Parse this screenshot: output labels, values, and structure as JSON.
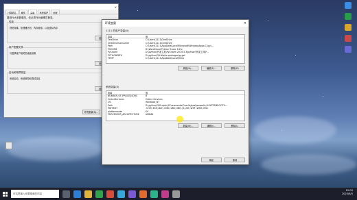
{
  "desktop": {
    "right_icons": [
      {
        "icon": "app-icon",
        "label": "",
        "color": "#3a8ee6"
      },
      {
        "icon": "app-icon",
        "label": "",
        "color": "#2a9d4a"
      },
      {
        "icon": "app-icon",
        "label": "",
        "color": "#d9a62e"
      },
      {
        "icon": "app-icon",
        "label": "",
        "color": "#c94a4a"
      },
      {
        "icon": "app-icon",
        "label": "",
        "color": "#6a6ad6"
      }
    ],
    "left_icon": {
      "icon": "document-icon",
      "label": ""
    }
  },
  "sysprops": {
    "tabs": [
      "计算机名",
      "硬件",
      "高级",
      "系统保护",
      "远程"
    ],
    "active_tab": 2,
    "note": "要进行大多数更改，你必须作为管理员登录。",
    "groups": [
      {
        "title": "性能",
        "desc": "视觉效果，处理器计划，内存使用，以及虚拟内存",
        "button": "设置(S)..."
      },
      {
        "title": "用户配置文件",
        "desc": "与登录帐户相关的桌面设置",
        "button": "设置(E)..."
      },
      {
        "title": "启动和故障恢复",
        "desc": "系统启动、系统故障和调试信息",
        "button": "设置(T)..."
      }
    ],
    "env_button": "环境变量(N)..."
  },
  "env": {
    "title": "环境变量",
    "close": "×",
    "user_section_label": "1111 的用户变量(U)",
    "columns": [
      "变量",
      "值"
    ],
    "user_vars": [
      {
        "name": "OneDrive",
        "value": "C:\\Users\\1111\\OneDrive"
      },
      {
        "name": "OneDriveConsumer",
        "value": "C:\\Users\\1111\\OneDrive"
      },
      {
        "name": "Path",
        "value": "C:\\Users\\1111\\AppData\\Local\\Microsoft\\WindowsApps;C:\\py\\..."
      },
      {
        "name": "PSHOME",
        "value": "D:\\WordCloud Python Tracer 6.2\\v"
      },
      {
        "name": "PyCharm",
        "value": "D:\\python\\开发工具\\PyCharm 2019.3.3\\python\\开发工具\\P..."
      },
      {
        "name": "PYTHONPATH",
        "value": "D:\\python\\3\\Lib\\site-packages\\pygal"
      },
      {
        "name": "TEMP",
        "value": "C:\\Users\\1111\\AppData\\Local\\Temp"
      }
    ],
    "user_buttons": [
      "新建(N)...",
      "编辑(E)...",
      "删除(D)"
    ],
    "sys_section_label": "系统变量(S)",
    "sys_vars": [
      {
        "name": "NUMBER_OF_PROCESSORS",
        "value": "8"
      },
      {
        "name": "OnlineServices",
        "value": "Online Services"
      },
      {
        "name": "OS",
        "value": "Windows_NT"
      },
      {
        "name": "Path",
        "value": "D:\\python\\3\\Scripts\\;D:\\anaconda\\Oracle\\Java\\javapath;%SYSTEMROOT%..."
      },
      {
        "name": "PATHEXT",
        "value": ".COM;.EXE;.BAT;.CMD;.VBS;.VBE;.JS;.JSE;.WSF;.WSH;.MSC"
      },
      {
        "name": "platformcode",
        "value": "KV"
      },
      {
        "name": "PROCESSOR_ARCHITECTURE",
        "value": "AMD64"
      }
    ],
    "sys_buttons": [
      "新建(W)...",
      "编辑(I)...",
      "删除(L)"
    ],
    "ok": "确定",
    "cancel": "取消"
  },
  "taskbar": {
    "search_placeholder": "在这里输入你要搜索的内容",
    "apps": [
      {
        "icon": "task-view-icon",
        "color": "#5a6270"
      },
      {
        "icon": "browser-icon",
        "color": "#2d7fd6"
      },
      {
        "icon": "explorer-icon",
        "color": "#e2b33a"
      },
      {
        "icon": "app-icon",
        "color": "#2fa24b"
      },
      {
        "icon": "app-icon",
        "color": "#d64b3a"
      },
      {
        "icon": "app-icon",
        "color": "#35a7d9"
      },
      {
        "icon": "app-icon",
        "color": "#7c5ad6"
      },
      {
        "icon": "app-icon",
        "color": "#e26a2c"
      },
      {
        "icon": "app-icon",
        "color": "#2ab38a"
      },
      {
        "icon": "app-icon",
        "color": "#c23b8e"
      },
      {
        "icon": "app-icon",
        "color": "#999999"
      }
    ],
    "time": "12:05",
    "date": "2020/6/5"
  }
}
